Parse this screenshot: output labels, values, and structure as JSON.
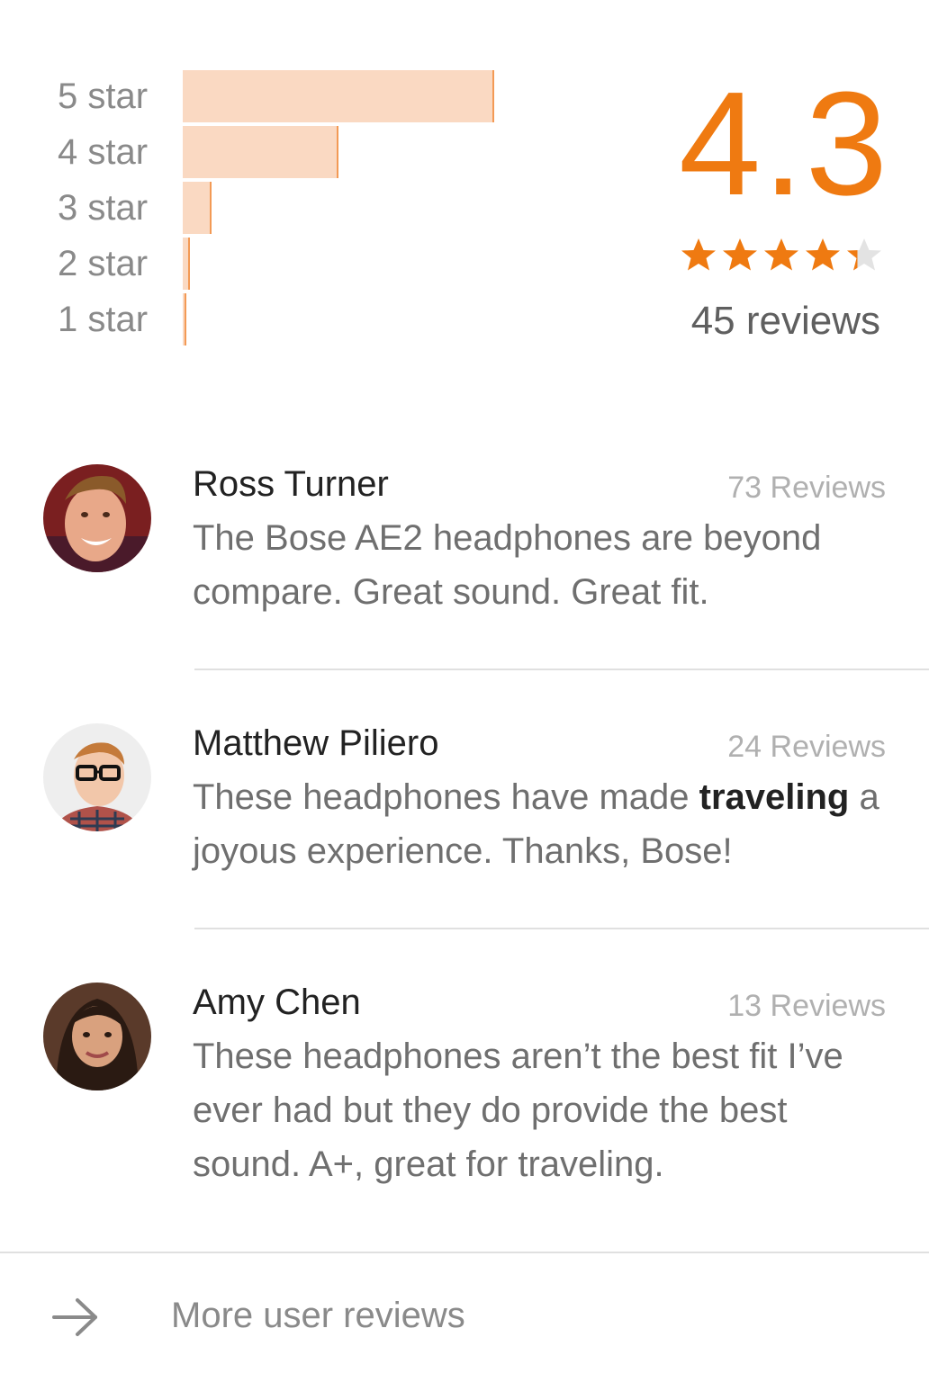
{
  "rating_summary": {
    "average": "4.3",
    "stars_value": 4.3,
    "stars_max": 5,
    "review_count_label": "45 reviews",
    "accent_color": "#ef7a11",
    "bar_color": "#fad9c2",
    "distribution": [
      {
        "label": "5 star",
        "fraction": 0.64
      },
      {
        "label": "4 star",
        "fraction": 0.32
      },
      {
        "label": "3 star",
        "fraction": 0.06
      },
      {
        "label": "2 star",
        "fraction": 0.015
      },
      {
        "label": "1 star",
        "fraction": 0.005
      }
    ]
  },
  "reviews": [
    {
      "name": "Ross Turner",
      "count_label": "73 Reviews",
      "text_before": "The Bose AE2 headphones are beyond compare. Great sound. Great fit.",
      "text_bold": "",
      "text_after": ""
    },
    {
      "name": "Matthew Piliero",
      "count_label": "24 Reviews",
      "text_before": "These headphones have made ",
      "text_bold": "traveling",
      "text_after": " a joyous experience. Thanks, Bose!"
    },
    {
      "name": "Amy Chen",
      "count_label": "13 Reviews",
      "text_before": "These headphones aren’t the best fit I’ve ever had but they do provide the best sound. A+, great for traveling.",
      "text_bold": "",
      "text_after": ""
    }
  ],
  "footer": {
    "more_label": "More user reviews",
    "icon": "arrow-right-icon"
  }
}
